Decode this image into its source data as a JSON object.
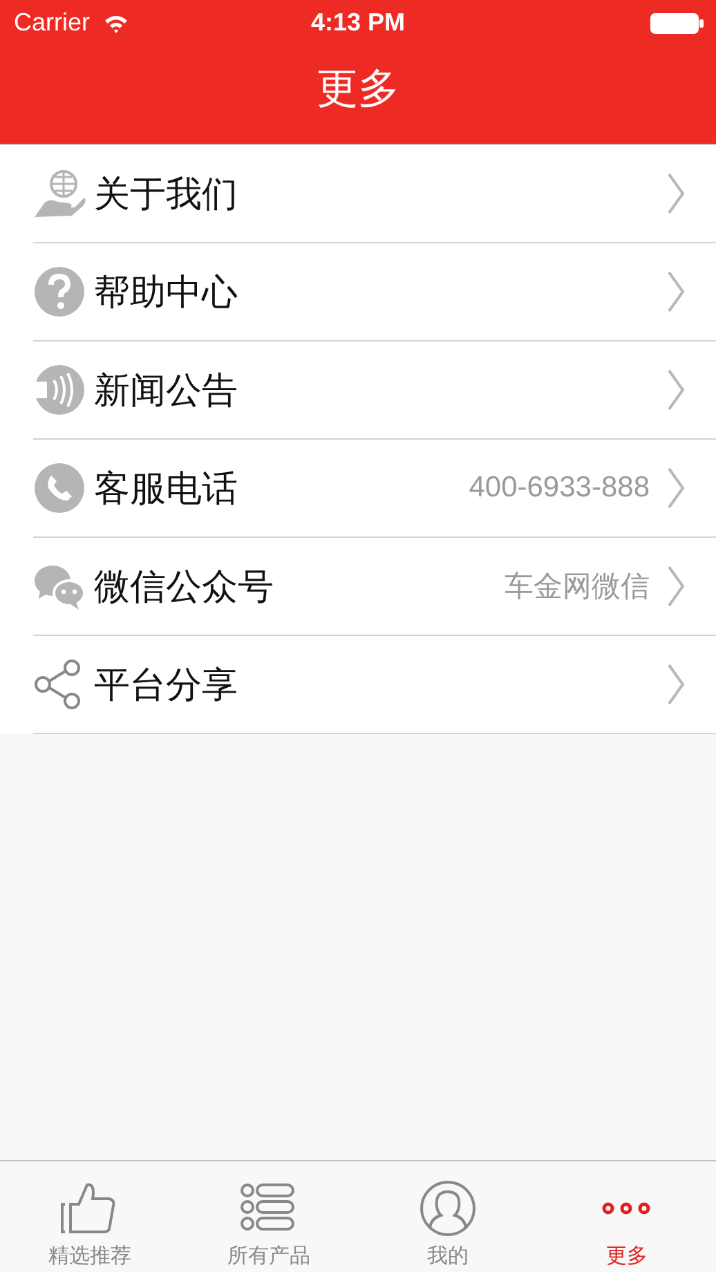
{
  "status_bar": {
    "carrier": "Carrier",
    "time": "4:13 PM"
  },
  "nav_bar": {
    "title": "更多"
  },
  "menu": [
    {
      "kind": "about",
      "label": "关于我们"
    },
    {
      "kind": "help",
      "label": "帮助中心"
    },
    {
      "kind": "news",
      "label": "新闻公告"
    },
    {
      "kind": "phone",
      "label": "客服电话",
      "detail": "400-6933-888"
    },
    {
      "kind": "wechat",
      "label": "微信公众号",
      "detail": "车金网微信"
    },
    {
      "kind": "share",
      "label": "平台分享"
    }
  ],
  "tab_bar": [
    {
      "kind": "thumb",
      "label": "精选推荐",
      "selected": false
    },
    {
      "kind": "list",
      "label": "所有产品",
      "selected": false
    },
    {
      "kind": "user",
      "label": "我的",
      "selected": false
    },
    {
      "kind": "more",
      "label": "更多",
      "selected": true
    }
  ]
}
